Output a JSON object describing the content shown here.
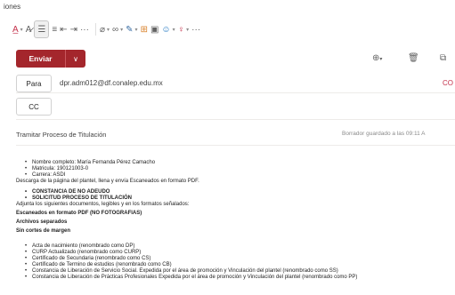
{
  "ribbon": {
    "tab_label": "iones",
    "more_label": "···"
  },
  "toolbar": {
    "send_label": "Enviar"
  },
  "to_field": {
    "label": "Para",
    "value": "dpr.adm012@df.conalep.edu.mx",
    "right_label": "CO"
  },
  "cc_field": {
    "label": "CC"
  },
  "subject": "Tramitar Proceso de Titulación",
  "draft_status": "Borrador guardado a las 09:11 A",
  "body": {
    "list1": [
      "Nombre completo: María Fernanda Pérez Camacho",
      "Matricula: 190121003-0",
      "Carrera: ASDI"
    ],
    "line1": "Descarga de la página del plantel, llena y envía Escaneados en formato PDF.",
    "list2": [
      "CONSTANCIA DE NO ADEUDO",
      "SOLICITUD PROCESO DE TITULACIÓN"
    ],
    "line2": "Adjunta los siguientes documentos, legibles y en los formatos señalados:",
    "line3": "Escaneados en formato PDF (NO FOTOGRAFIAS)",
    "line4": "Archivos separados",
    "line5": "Sin cortes de margen",
    "list3": [
      "Acta de nacimiento (renombrado como DP)",
      "CURP Actualizado (renombrado como CURP)",
      "Certificado de Secundaria (renombrado como CS)",
      "Certificado de Termino de estudios (renombrado como CB)",
      "Constancia de Liberación de Servicio Social. Expedida por el área de promoción y Vinculación del plantel (renombrado como SS)",
      "Constancia de Liberación de Prácticas Profesionales Expedida por el área de promoción y Vinculación del plantel (renombrado como PP)"
    ]
  },
  "colors": {
    "send_button": "#a4262c",
    "accent_red": "#c4314b"
  }
}
